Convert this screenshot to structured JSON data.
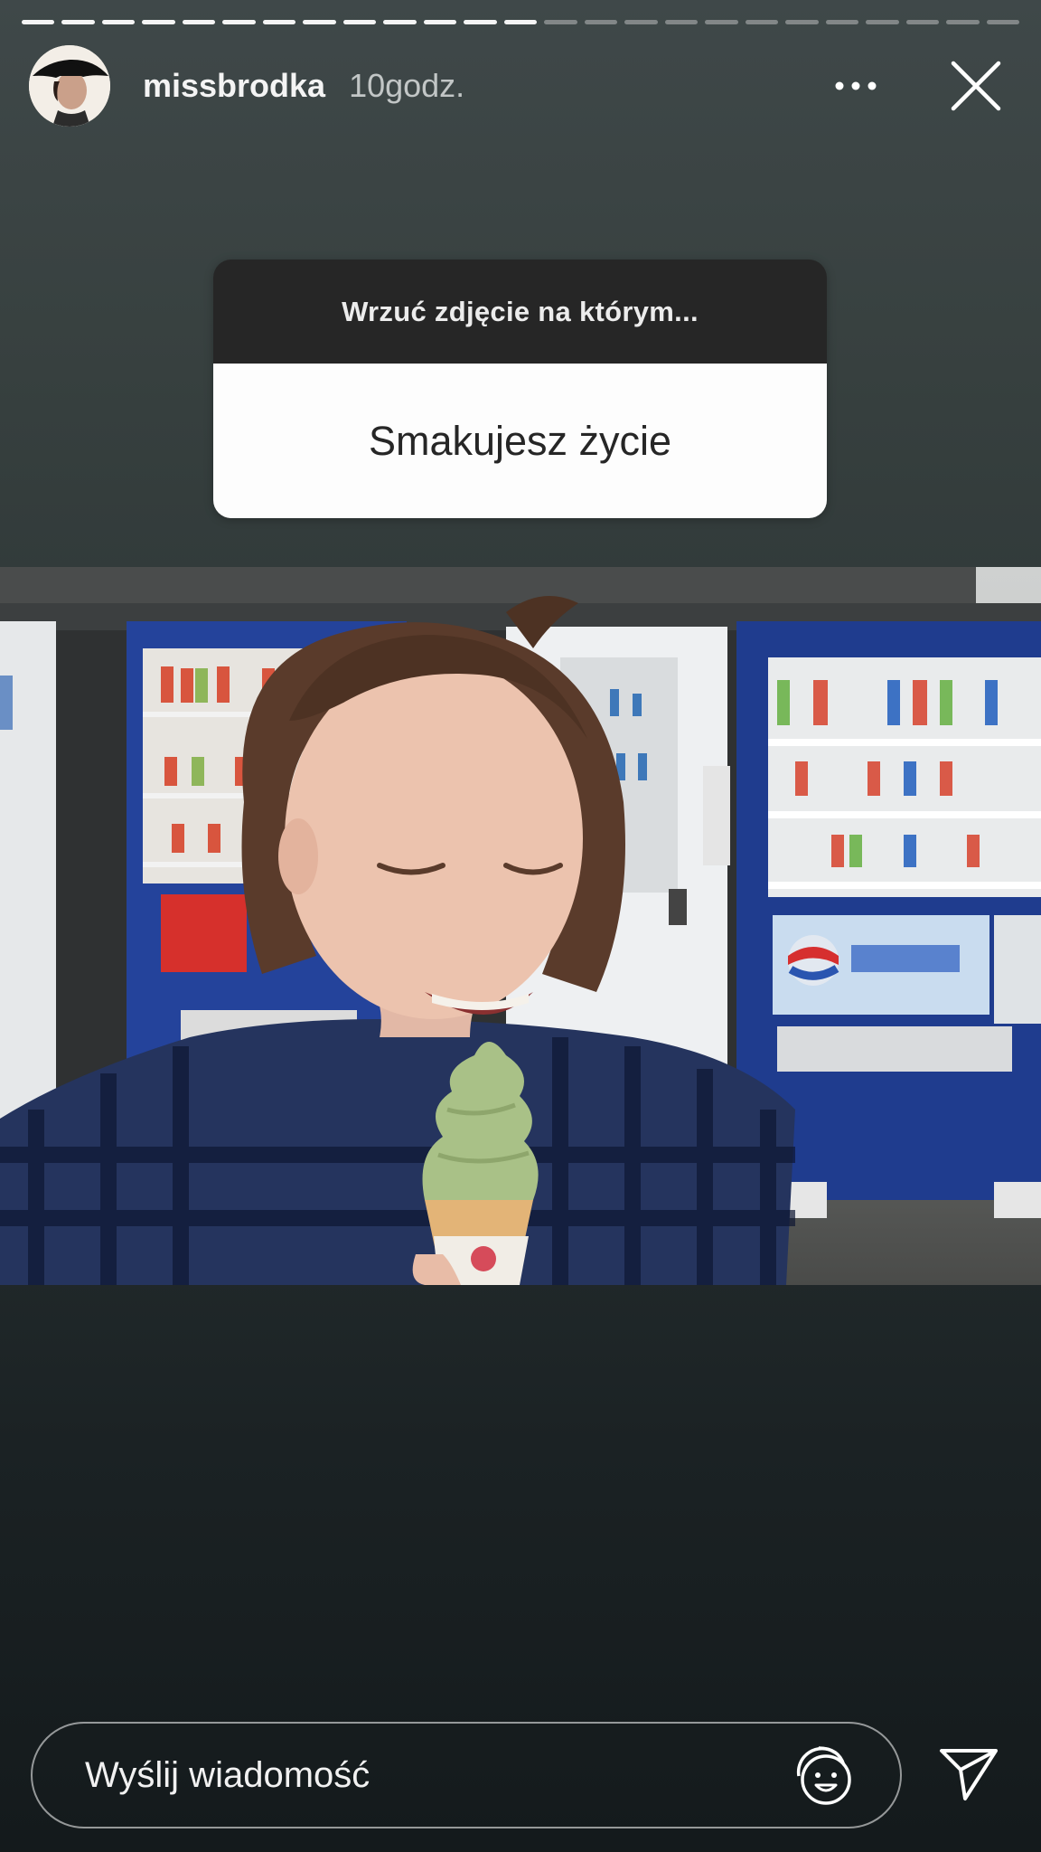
{
  "story": {
    "progress": {
      "segments_total": 25,
      "segments_done": 13
    },
    "header": {
      "avatar_icon": "profile-avatar",
      "username": "missbrodka",
      "time_ago": "10godz.",
      "more_icon": "more-horizontal-icon",
      "close_icon": "close-icon"
    },
    "question_sticker": {
      "prompt": "Wrzuć zdjęcie na którym...",
      "answer": "Smakujesz życie"
    },
    "photo": {
      "description_icon": "story-photo"
    },
    "composer": {
      "placeholder": "Wyślij wiadomość",
      "sticker_icon": "sticker-emoji-icon",
      "send_icon": "paper-plane-send-icon"
    }
  }
}
